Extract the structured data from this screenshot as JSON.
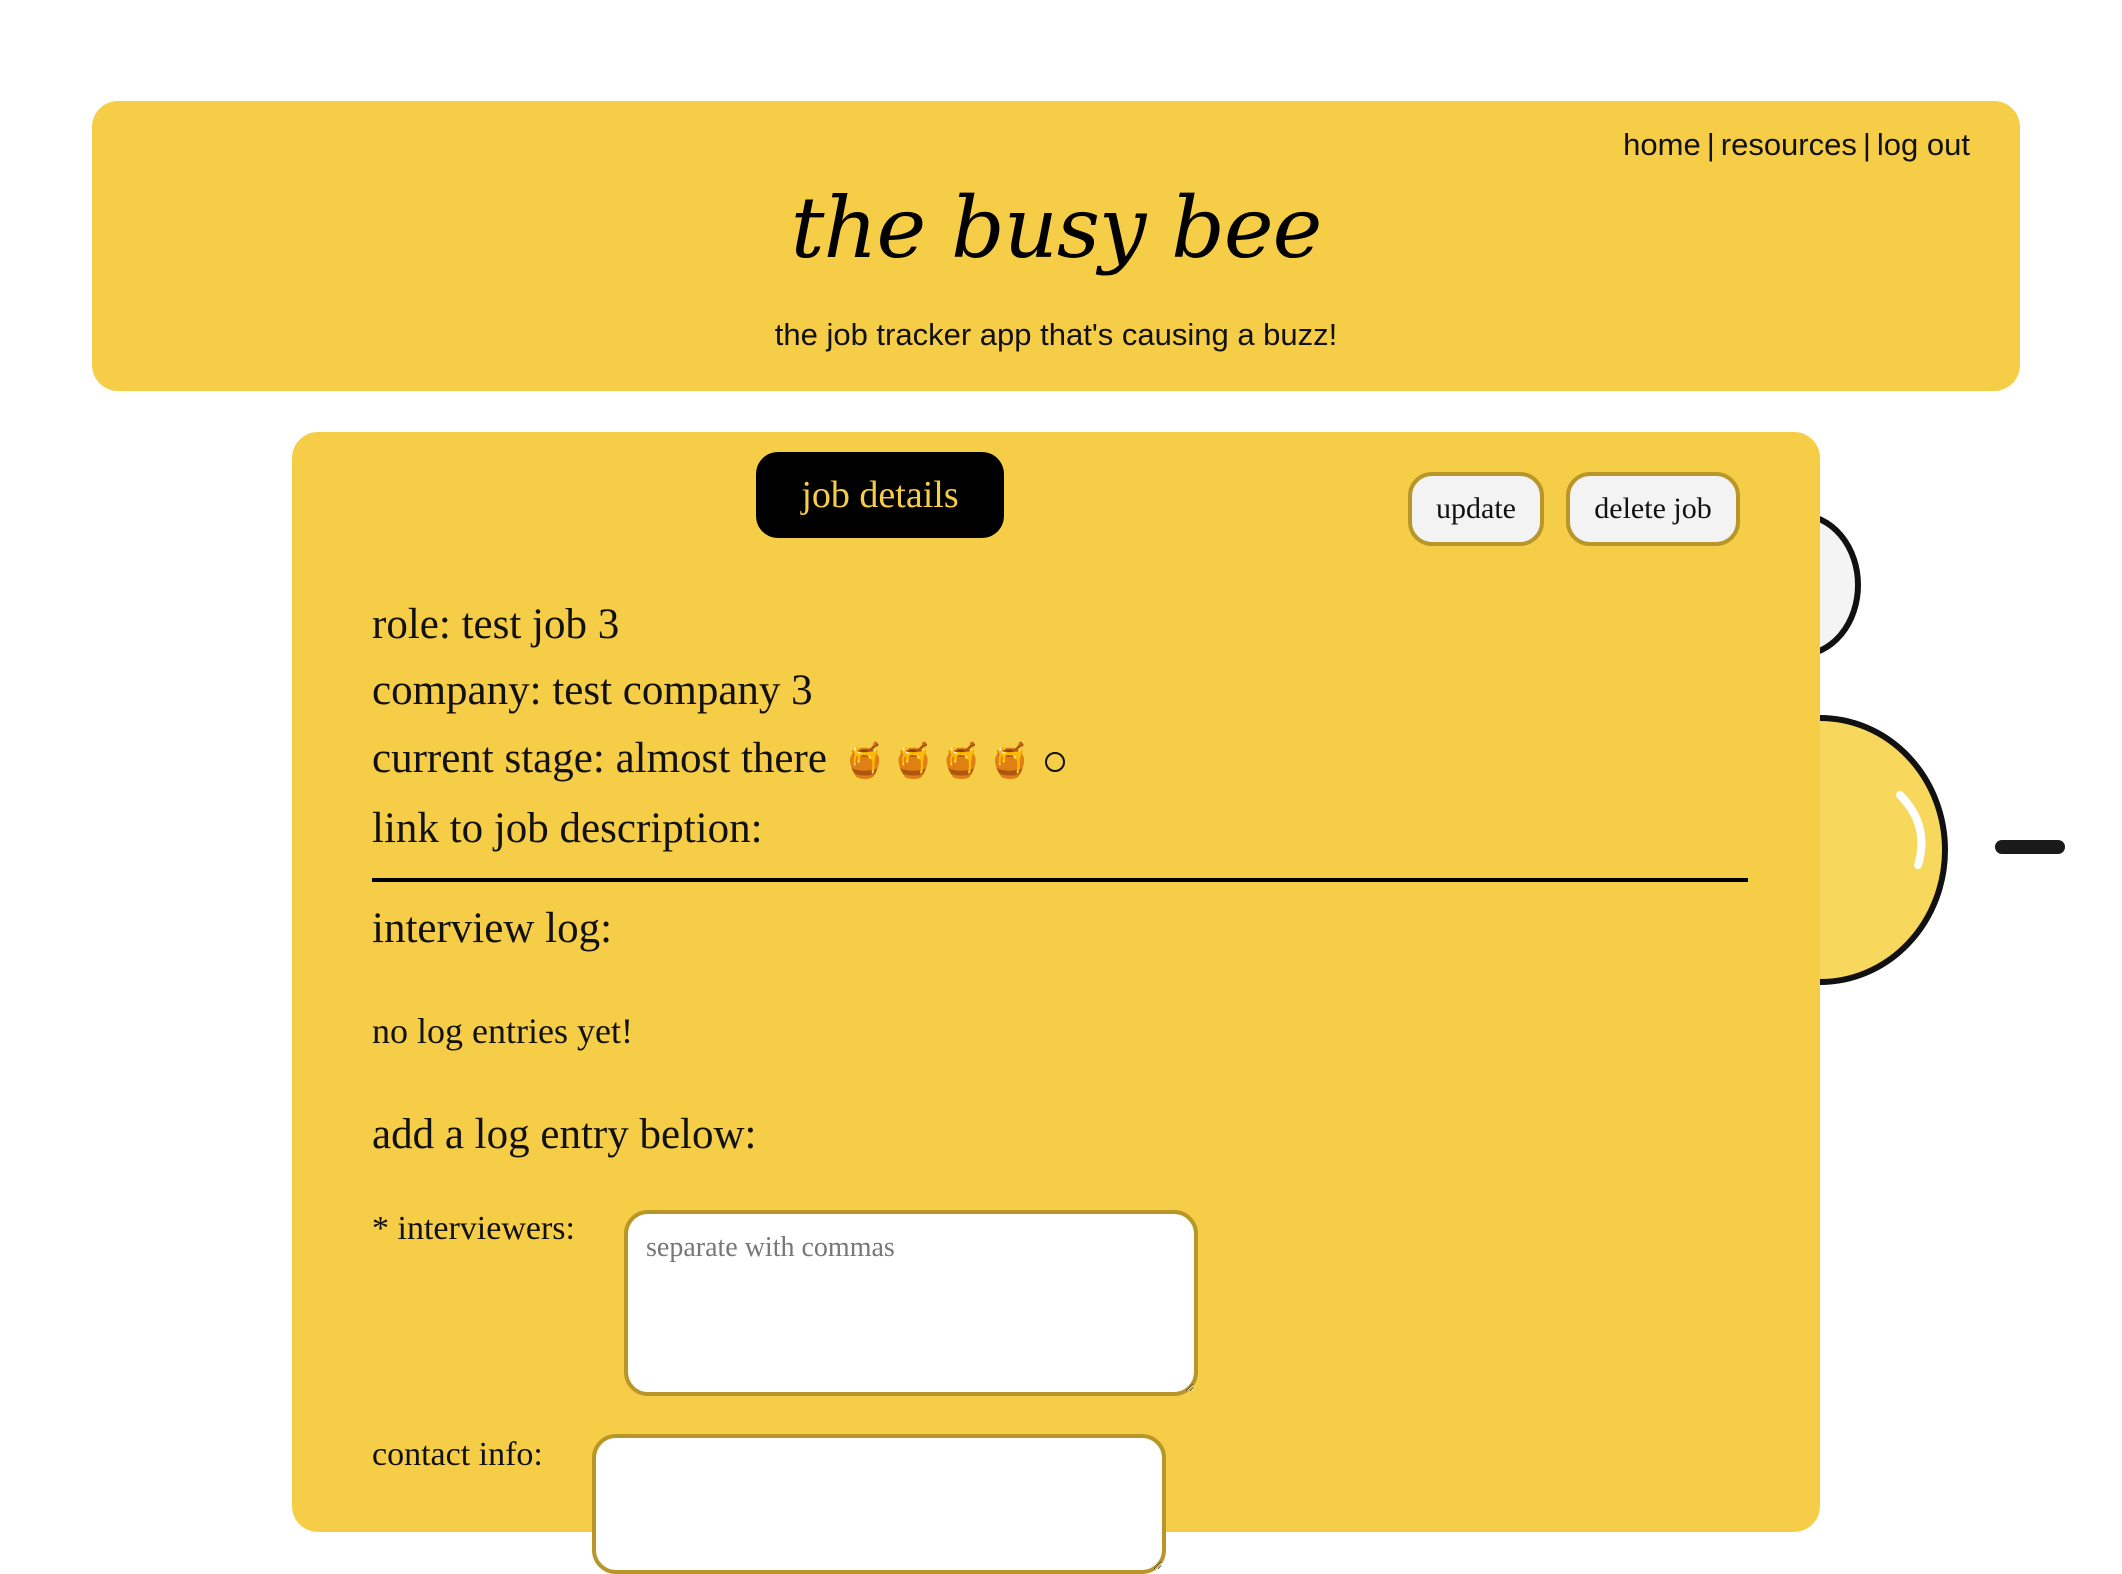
{
  "header": {
    "nav": [
      {
        "label": "home"
      },
      {
        "label": "resources"
      },
      {
        "label": "log out"
      }
    ],
    "nav_separator": "|",
    "title": "the busy bee",
    "tagline": "the job tracker app that's causing a buzz!"
  },
  "card": {
    "title": "job details",
    "buttons": {
      "update": "update",
      "delete": "delete job"
    },
    "fields": {
      "role_label": "role:",
      "role_value": "test job 3",
      "company_label": "company:",
      "company_value": "test company 3",
      "stage_label": "current stage:",
      "stage_value": "almost there",
      "stage_icon": "honey-pot-icon",
      "stage_progress": {
        "filled": 4,
        "total": 5
      },
      "link_label": "link to job description:"
    },
    "interview_log": {
      "heading": "interview log:",
      "empty_text": "no log entries yet!"
    },
    "add_log": {
      "heading": "add a log entry below:",
      "interviewers_label": "* interviewers:",
      "interviewers_placeholder": "separate with commas",
      "interviewers_value": "",
      "contact_label": "contact info:",
      "contact_value": ""
    }
  },
  "colors": {
    "brand_yellow": "#f6cd46",
    "title_bg": "#000000",
    "button_border": "#b8962a",
    "button_bg": "#f3f3f3"
  }
}
